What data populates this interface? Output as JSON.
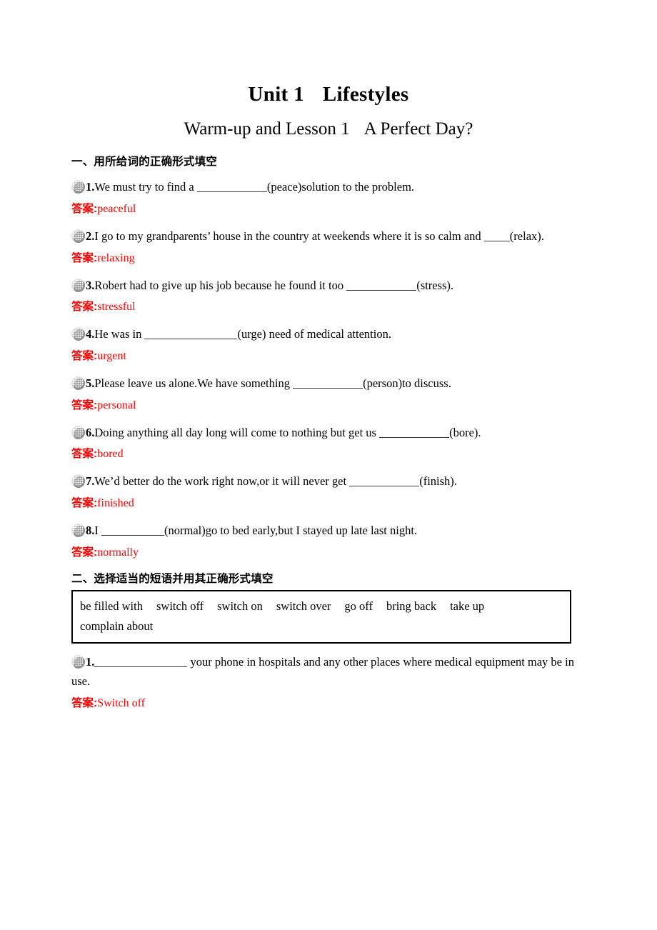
{
  "document": {
    "unit_title_left": "Unit 1",
    "unit_title_right": "Lifestyles",
    "lesson_title_left": "Warm-up and Lesson 1",
    "lesson_title_right": "A Perfect Day?",
    "answer_label": "答案",
    "answer_colon": ":",
    "answer_color": "#FF0000"
  },
  "sections": [
    {
      "heading": "一、用所给词的正确形式填空",
      "questions": [
        {
          "number": "1.",
          "text_before": "We must try to find a ",
          "blank": "w-m",
          "text_after": "(peace)solution to the problem.",
          "answer": "peaceful"
        },
        {
          "number": "2.",
          "text_before": "I go to my grandparents’  house in the country at weekends where it is so calm and ",
          "blank": "w-xs",
          "text_after": "(relax).",
          "answer": "relaxing"
        },
        {
          "number": "3.",
          "text_before": "Robert had to give up his job because he found it too ",
          "blank": "w-m",
          "text_after": "(stress).",
          "answer": "stressful"
        },
        {
          "number": "4.",
          "text_before": "He was in ",
          "blank": "w-xl",
          "text_after": "(urge) need of medical attention.",
          "answer": "urgent"
        },
        {
          "number": "5.",
          "text_before": "Please leave us alone.We have something ",
          "blank": "w-m",
          "text_after": "(person)to discuss.",
          "answer": "personal"
        },
        {
          "number": "6.",
          "text_before": "Doing anything all day long will come to nothing but get us ",
          "blank": "w-m",
          "text_after": "(bore).",
          "answer": "bored"
        },
        {
          "number": "7.",
          "text_before": "We’d better do the work right now,or it will never get ",
          "blank": "w-m",
          "text_after": "(finish).",
          "answer": "finished"
        },
        {
          "number": "8.",
          "text_before": "I ",
          "blank": "w-s",
          "text_after": "(normal)go to bed early,but I stayed up late last night.",
          "answer": "normally"
        }
      ]
    },
    {
      "heading": "二、选择适当的短语并用其正确形式填空",
      "wordbank": [
        "be filled with",
        "switch off",
        "switch on",
        "switch over",
        "go off",
        "bring back",
        "take up",
        "complain about"
      ],
      "questions": [
        {
          "number": "1.",
          "text_before": "",
          "blank": "w-xl",
          "text_after": " your phone in hospitals and any other places where medical equipment may be in use.",
          "answer": "Switch off"
        }
      ]
    }
  ]
}
